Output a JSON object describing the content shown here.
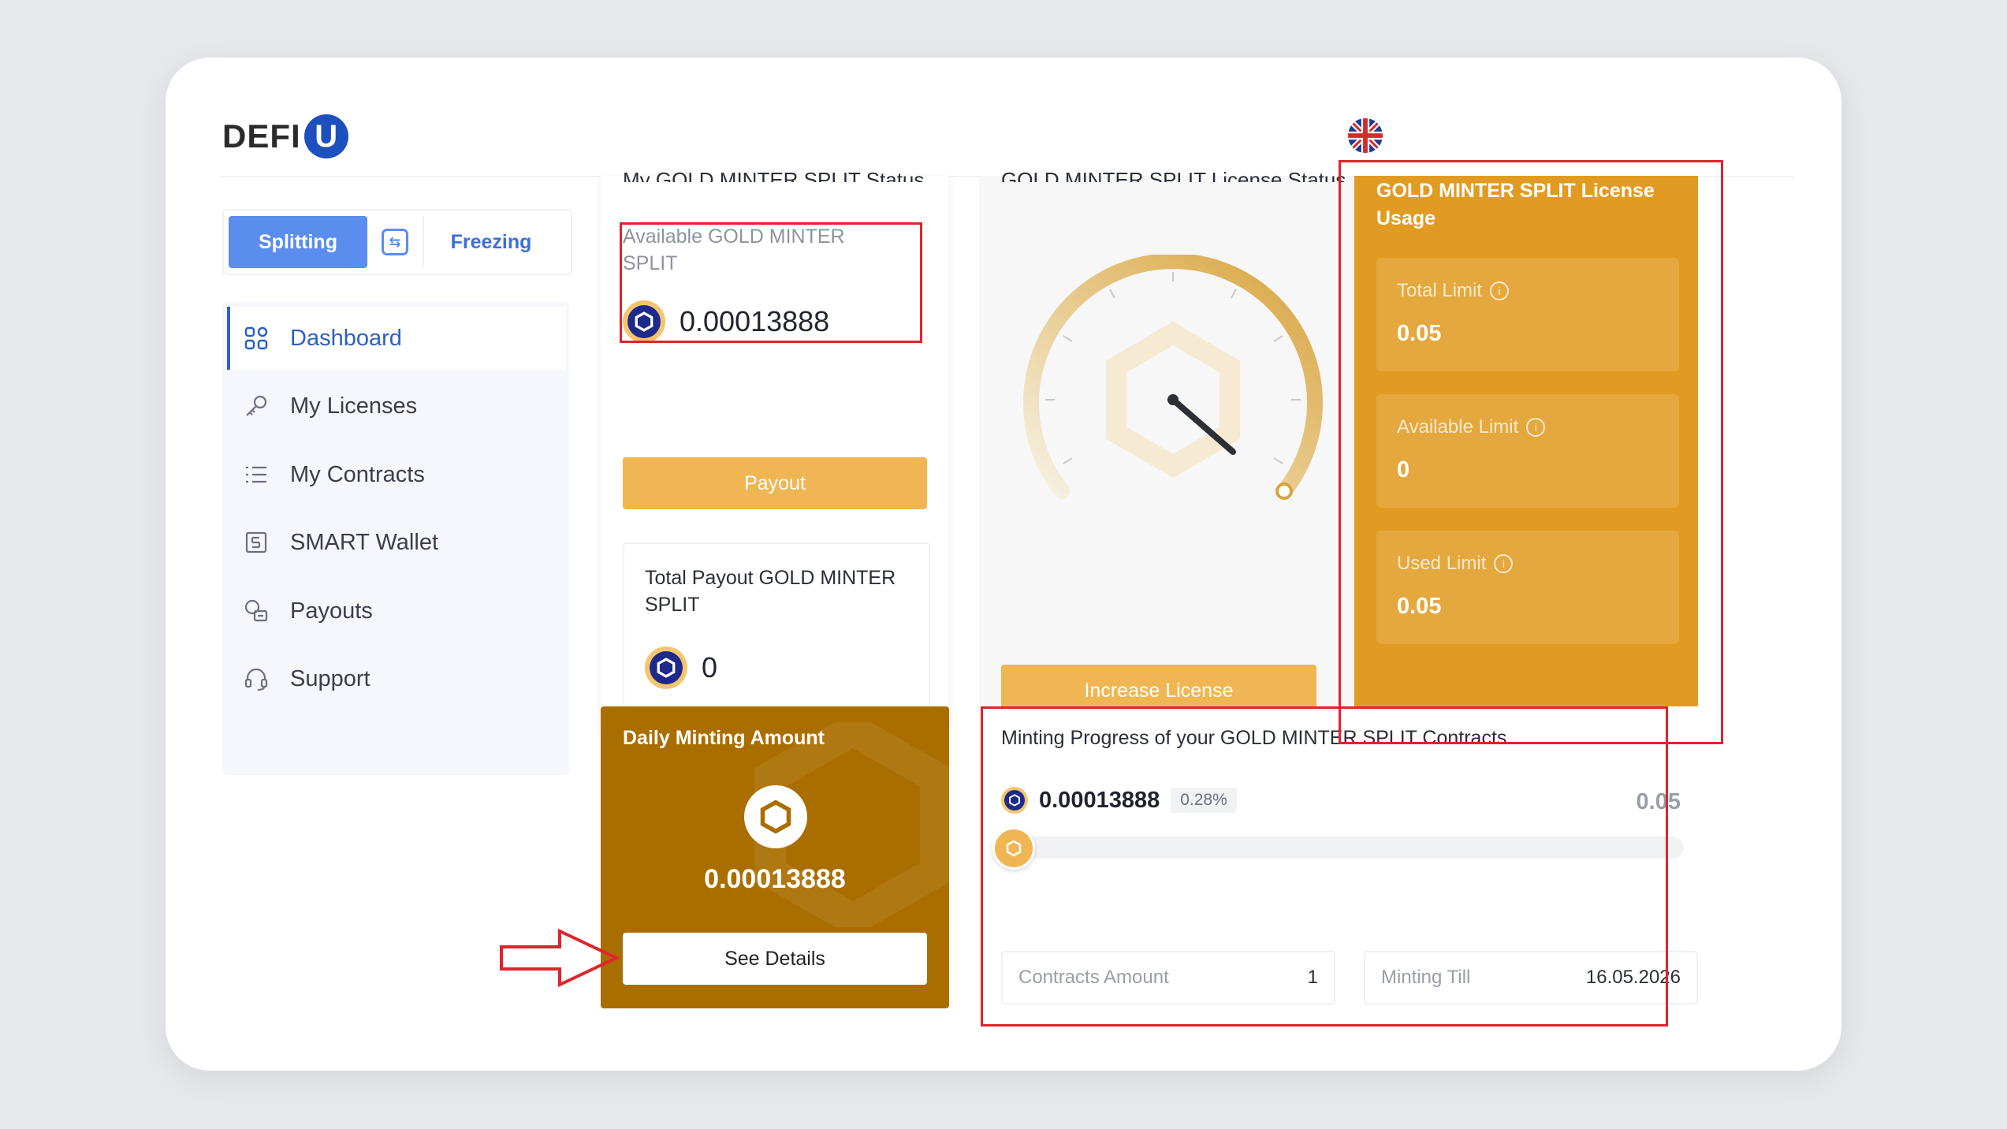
{
  "header": {
    "logo_text": "DEFI",
    "logo_mark": "U",
    "language_flag": "uk-flag-icon"
  },
  "mode_switch": {
    "active_label": "Splitting",
    "swap_icon": "swap-icon",
    "other_label": "Freezing"
  },
  "sidebar": {
    "items": [
      {
        "label": "Dashboard",
        "icon": "grid-icon",
        "active": true
      },
      {
        "label": "My Licenses",
        "icon": "key-icon"
      },
      {
        "label": "My Contracts",
        "icon": "list-icon"
      },
      {
        "label": "SMART Wallet",
        "icon": "wallet-icon"
      },
      {
        "label": "Payouts",
        "icon": "payout-icon"
      },
      {
        "label": "Support",
        "icon": "headset-icon"
      }
    ]
  },
  "status_card": {
    "title": "My GOLD MINTER SPLIT Status",
    "available_label": "Available GOLD MINTER SPLIT",
    "available_value": "0.00013888",
    "payout_button": "Payout",
    "total_payout_label": "Total Payout GOLD MINTER SPLIT",
    "total_payout_value": "0"
  },
  "license_card": {
    "title": "GOLD MINTER SPLIT License Status",
    "increase_button": "Increase License"
  },
  "usage_card": {
    "title": "GOLD MINTER SPLIT License Usage",
    "total_limit_label": "Total Limit",
    "total_limit_value": "0.05",
    "available_limit_label": "Available Limit",
    "available_limit_value": "0",
    "used_limit_label": "Used Limit",
    "used_limit_value": "0.05"
  },
  "daily_card": {
    "title": "Daily Minting Amount",
    "value": "0.00013888",
    "button": "See Details"
  },
  "progress_card": {
    "title": "Minting Progress of your GOLD MINTER SPLIT Contracts",
    "current": "0.00013888",
    "percent": "0.28%",
    "percent_value": 0.28,
    "max": "0.05",
    "contracts_label": "Contracts Amount",
    "contracts_value": "1",
    "minting_till_label": "Minting Till",
    "minting_till_value": "16.05.2026"
  },
  "colors": {
    "brand_blue": "#1e4fbf",
    "gold": "#f0b653",
    "usage_orange": "#e29b22",
    "daily_brown": "#aa6e00",
    "highlight_red": "#e0242c"
  }
}
